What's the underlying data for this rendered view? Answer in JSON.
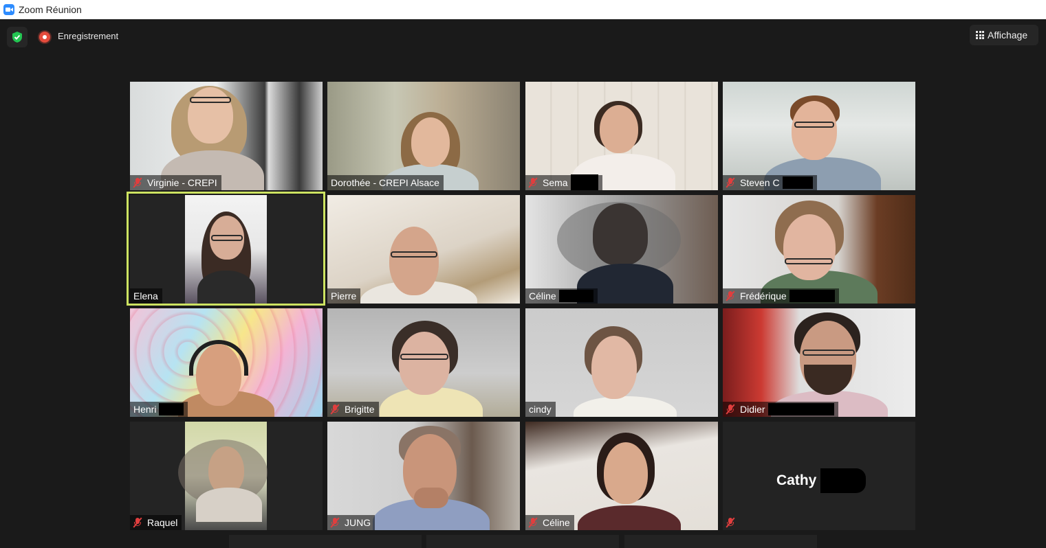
{
  "window": {
    "title": "Zoom Réunion"
  },
  "toolbar": {
    "recording_label": "Enregistrement",
    "view_label": "Affichage"
  },
  "participants": [
    {
      "name": "Virginie - CREPI",
      "muted": true
    },
    {
      "name": "Dorothée - CREPI Alsace",
      "muted": false
    },
    {
      "name": "Sema",
      "muted": true
    },
    {
      "name": "Steven C",
      "muted": true
    },
    {
      "name": "Elena",
      "muted": false,
      "active_speaker": true
    },
    {
      "name": "Pierre",
      "muted": false
    },
    {
      "name": "Céline",
      "muted": false
    },
    {
      "name": "Frédérique",
      "muted": true
    },
    {
      "name": "Henri",
      "muted": false
    },
    {
      "name": "Brigitte",
      "muted": true
    },
    {
      "name": "cindy",
      "muted": false
    },
    {
      "name": "Didier",
      "muted": true
    },
    {
      "name": "Raquel",
      "muted": true
    },
    {
      "name": "JUNG",
      "muted": true
    },
    {
      "name": "Céline",
      "muted": true
    },
    {
      "name": "Cathy",
      "muted": true,
      "video_off": true
    }
  ],
  "colors": {
    "active_speaker_border": "#cde361",
    "muted_icon": "#e03e3e",
    "recording": "#e54b3c",
    "secure_shield": "#23c552"
  }
}
